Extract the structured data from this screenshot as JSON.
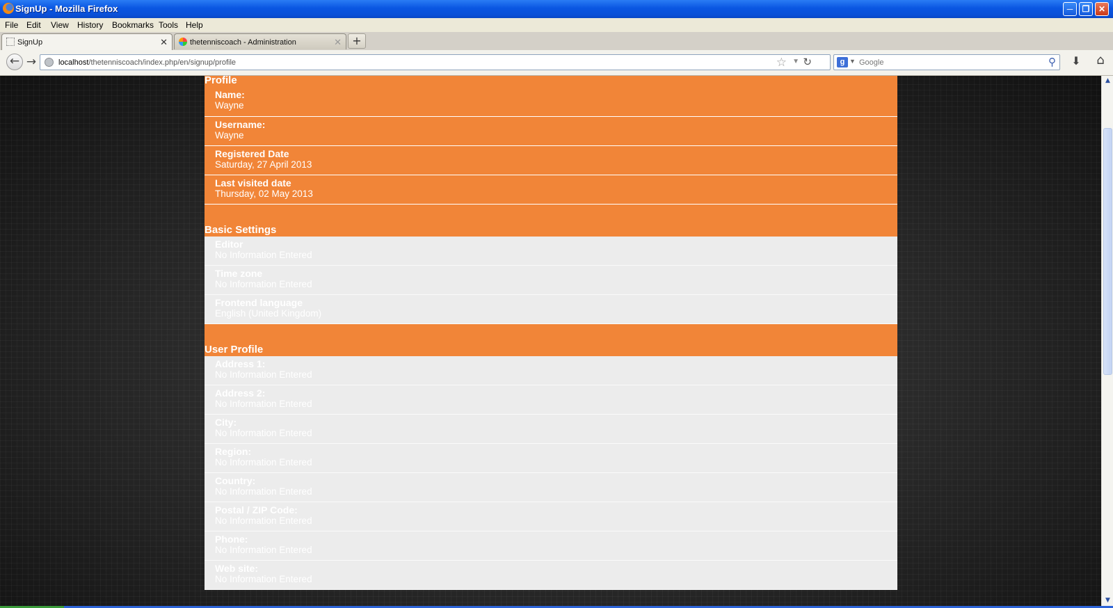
{
  "window": {
    "title": "SignUp - Mozilla Firefox"
  },
  "menu": [
    "File",
    "Edit",
    "View",
    "History",
    "Bookmarks",
    "Tools",
    "Help"
  ],
  "tabs": [
    {
      "label": "SignUp",
      "active": true
    },
    {
      "label": "thetenniscoach - Administration",
      "active": false
    }
  ],
  "url": {
    "host": "localhost",
    "path": "/thetenniscoach/index.php/en/signup/profile"
  },
  "search": {
    "placeholder": "Google"
  },
  "sections": {
    "profile": {
      "title": "Profile",
      "fields": [
        {
          "label": "Name:",
          "value": "Wayne"
        },
        {
          "label": "Username:",
          "value": "Wayne"
        },
        {
          "label": "Registered Date",
          "value": "Saturday, 27 April 2013"
        },
        {
          "label": "Last visited date",
          "value": "Thursday, 02 May 2013"
        }
      ]
    },
    "basic": {
      "title": "Basic Settings",
      "fields": [
        {
          "label": "Editor",
          "value": "No Information Entered"
        },
        {
          "label": "Time zone",
          "value": "No Information Entered"
        },
        {
          "label": "Frontend language",
          "value": "English (United Kingdom)"
        }
      ]
    },
    "user_profile": {
      "title": "User Profile",
      "fields": [
        {
          "label": "Address 1:",
          "value": "No Information Entered"
        },
        {
          "label": "Address 2:",
          "value": "No Information Entered"
        },
        {
          "label": "City:",
          "value": "No Information Entered"
        },
        {
          "label": "Region:",
          "value": "No Information Entered"
        },
        {
          "label": "Country:",
          "value": "No Information Entered"
        },
        {
          "label": "Postal / ZIP Code:",
          "value": "No Information Entered"
        },
        {
          "label": "Phone:",
          "value": "No Information Entered"
        },
        {
          "label": "Web site:",
          "value": "No Information Entered"
        }
      ]
    }
  },
  "colors": {
    "accent": "#f18538",
    "grey_row": "#ececec",
    "titlebar": "#0a56e2"
  }
}
